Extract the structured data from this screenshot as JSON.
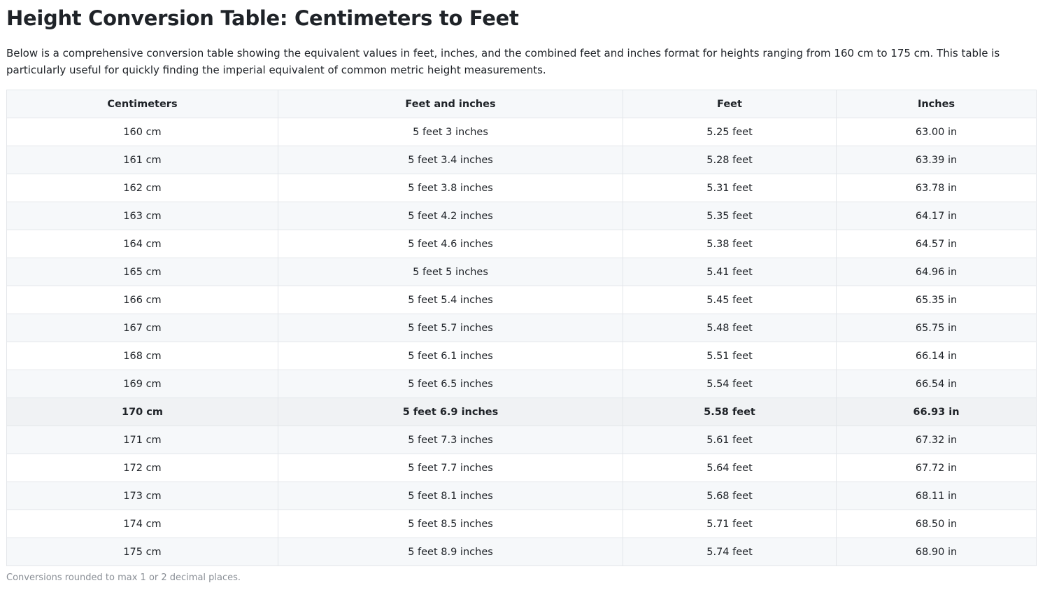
{
  "title": "Height Conversion Table: Centimeters to Feet",
  "intro": "Below is a comprehensive conversion table showing the equivalent values in feet, inches, and the combined feet and inches format for heights ranging from 160 cm to 175 cm. This table is particularly useful for quickly finding the imperial equivalent of common metric height measurements.",
  "table": {
    "headers": [
      "Centimeters",
      "Feet and inches",
      "Feet",
      "Inches"
    ],
    "rows": [
      {
        "cm": "160 cm",
        "ftin": "5 feet 3 inches",
        "ft": "5.25 feet",
        "in": "63.00 in"
      },
      {
        "cm": "161 cm",
        "ftin": "5 feet 3.4 inches",
        "ft": "5.28 feet",
        "in": "63.39 in"
      },
      {
        "cm": "162 cm",
        "ftin": "5 feet 3.8 inches",
        "ft": "5.31 feet",
        "in": "63.78 in"
      },
      {
        "cm": "163 cm",
        "ftin": "5 feet 4.2 inches",
        "ft": "5.35 feet",
        "in": "64.17 in"
      },
      {
        "cm": "164 cm",
        "ftin": "5 feet 4.6 inches",
        "ft": "5.38 feet",
        "in": "64.57 in"
      },
      {
        "cm": "165 cm",
        "ftin": "5 feet 5 inches",
        "ft": "5.41 feet",
        "in": "64.96 in"
      },
      {
        "cm": "166 cm",
        "ftin": "5 feet 5.4 inches",
        "ft": "5.45 feet",
        "in": "65.35 in"
      },
      {
        "cm": "167 cm",
        "ftin": "5 feet 5.7 inches",
        "ft": "5.48 feet",
        "in": "65.75 in"
      },
      {
        "cm": "168 cm",
        "ftin": "5 feet 6.1 inches",
        "ft": "5.51 feet",
        "in": "66.14 in"
      },
      {
        "cm": "169 cm",
        "ftin": "5 feet 6.5 inches",
        "ft": "5.54 feet",
        "in": "66.54 in"
      },
      {
        "cm": "170 cm",
        "ftin": "5 feet 6.9 inches",
        "ft": "5.58 feet",
        "in": "66.93 in",
        "highlight": true
      },
      {
        "cm": "171 cm",
        "ftin": "5 feet 7.3 inches",
        "ft": "5.61 feet",
        "in": "67.32 in"
      },
      {
        "cm": "172 cm",
        "ftin": "5 feet 7.7 inches",
        "ft": "5.64 feet",
        "in": "67.72 in"
      },
      {
        "cm": "173 cm",
        "ftin": "5 feet 8.1 inches",
        "ft": "5.68 feet",
        "in": "68.11 in"
      },
      {
        "cm": "174 cm",
        "ftin": "5 feet 8.5 inches",
        "ft": "5.71 feet",
        "in": "68.50 in"
      },
      {
        "cm": "175 cm",
        "ftin": "5 feet 8.9 inches",
        "ft": "5.74 feet",
        "in": "68.90 in"
      }
    ]
  },
  "footnote": "Conversions rounded to max 1 or 2 decimal places."
}
